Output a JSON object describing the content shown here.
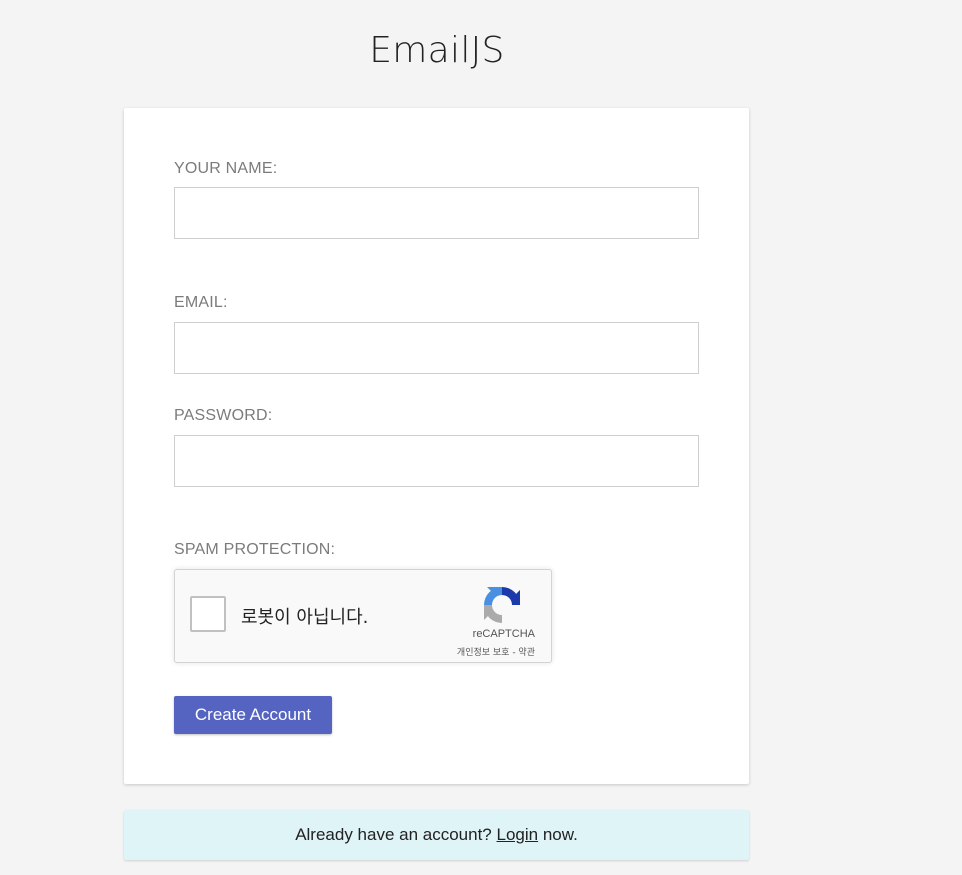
{
  "app": {
    "title": "EmailJS"
  },
  "form": {
    "name_label": "YOUR NAME:",
    "name_value": "",
    "email_label": "EMAIL:",
    "email_value": "",
    "password_label": "PASSWORD:",
    "password_value": "",
    "spam_label": "SPAM PROTECTION:",
    "submit_label": "Create Account"
  },
  "recaptcha": {
    "checkbox_text": "로봇이 아닙니다.",
    "brand": "reCAPTCHA",
    "links": "개인정보 보호 - 약관",
    "checked": false
  },
  "footer": {
    "prefix": "Already have an account? ",
    "link": "Login",
    "suffix": " now."
  },
  "colors": {
    "primary_button": "#5563c1",
    "footer_bg": "#dff4f7",
    "page_bg": "#f4f4f4"
  }
}
